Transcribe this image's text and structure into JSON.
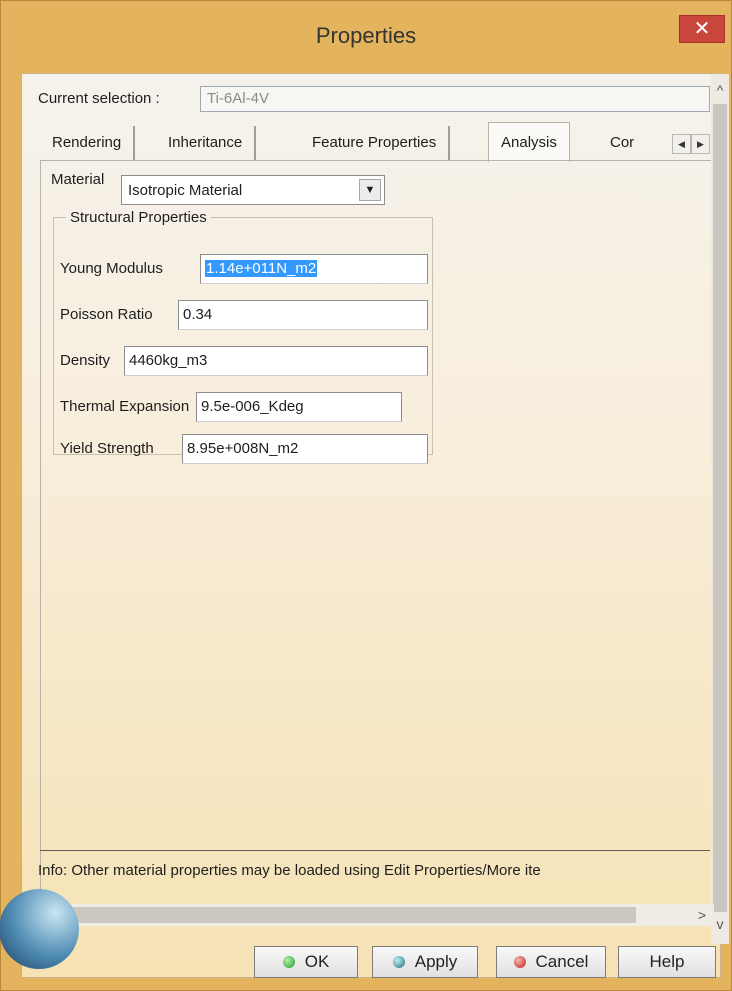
{
  "window": {
    "title": "Properties",
    "close_glyph": "✕"
  },
  "selection": {
    "label": "Current selection :",
    "value": "Ti-6Al-4V"
  },
  "tabs": [
    {
      "label": "Rendering"
    },
    {
      "label": "Inheritance"
    },
    {
      "label": "Feature Properties"
    },
    {
      "label": "Analysis"
    },
    {
      "label": "Cor"
    }
  ],
  "material": {
    "label": "Material",
    "value": "Isotropic Material"
  },
  "structural": {
    "legend": "Structural Properties",
    "fields": [
      {
        "label": "Young Modulus",
        "value": "1.14e+011N_m2"
      },
      {
        "label": "Poisson Ratio",
        "value": "0.34"
      },
      {
        "label": "Density",
        "value": "4460kg_m3"
      },
      {
        "label": "Thermal Expansion",
        "value": "9.5e-006_Kdeg"
      },
      {
        "label": "Yield Strength",
        "value": "8.95e+008N_m2"
      }
    ]
  },
  "info": {
    "text": "Info: Other material properties may be loaded using Edit Properties/More ite"
  },
  "buttons": {
    "ok": "OK",
    "apply": "Apply",
    "cancel": "Cancel",
    "help": "Help"
  },
  "icons": {
    "scroll_up": "^",
    "scroll_down": "v",
    "scroll_left": "<",
    "scroll_right": ">",
    "tab_left": "◀",
    "tab_right": "▶",
    "dropdown": "▼"
  },
  "colors": {
    "accent_selection": "#3399ff",
    "close_button": "#c9463d"
  }
}
